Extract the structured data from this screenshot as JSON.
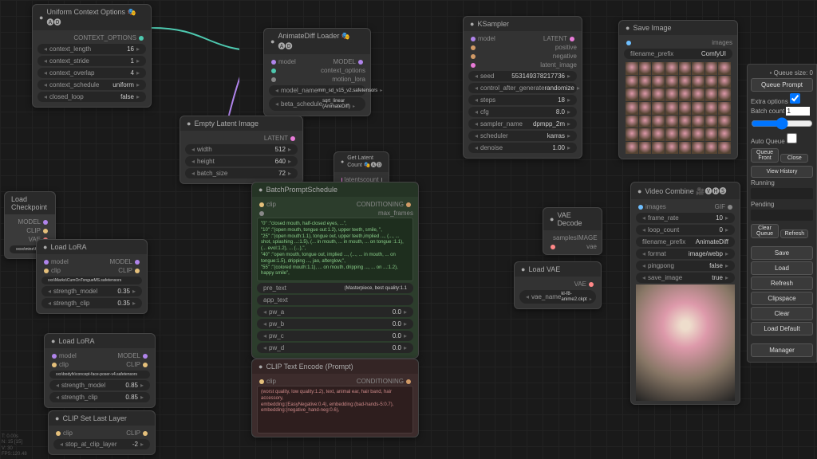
{
  "nodes": {
    "context_options": {
      "title": "Uniform Context Options 🎭🅐🅓",
      "out": "CONTEXT_OPTIONS",
      "widgets": {
        "context_length": {
          "label": "context_length",
          "value": "16"
        },
        "context_stride": {
          "label": "context_stride",
          "value": "1"
        },
        "context_overlap": {
          "label": "context_overlap",
          "value": "4"
        },
        "context_schedule": {
          "label": "context_schedule",
          "value": "uniform"
        },
        "closed_loop": {
          "label": "closed_loop",
          "value": "false"
        }
      }
    },
    "animatediff": {
      "title": "AnimateDiff Loader 🎭🅐🅓",
      "inputs": [
        "model",
        "context_options",
        "motion_lora"
      ],
      "out": "MODEL",
      "widgets": {
        "model_name": {
          "label": "model_name",
          "value": "mm_sd_v15_v2.safetensors"
        },
        "beta_schedule": {
          "label": "beta_schedule",
          "value": "sqrt_linear (AnimateDiff)"
        }
      }
    },
    "empty_latent": {
      "title": "Empty Latent Image",
      "out": "LATENT",
      "widgets": {
        "width": {
          "label": "width",
          "value": "512"
        },
        "height": {
          "label": "height",
          "value": "640"
        },
        "batch_size": {
          "label": "batch_size",
          "value": "72"
        }
      }
    },
    "get_latent_count": {
      "title": "Get Latent Count 🎭🅐🅓",
      "inputs": [
        "latents"
      ],
      "out": "count"
    },
    "ksampler": {
      "title": "KSampler",
      "inputs": [
        "model",
        "positive",
        "negative",
        "latent_image"
      ],
      "out": "LATENT",
      "widgets": {
        "seed": {
          "label": "seed",
          "value": "553149378217736"
        },
        "control_after_generate": {
          "label": "control_after_generate",
          "value": "randomize"
        },
        "steps": {
          "label": "steps",
          "value": "18"
        },
        "cfg": {
          "label": "cfg",
          "value": "8.0"
        },
        "sampler_name": {
          "label": "sampler_name",
          "value": "dpmpp_2m"
        },
        "scheduler": {
          "label": "scheduler",
          "value": "karras"
        },
        "denoise": {
          "label": "denoise",
          "value": "1.00"
        }
      }
    },
    "save_image": {
      "title": "Save Image",
      "inputs": [
        "images"
      ],
      "widgets": {
        "filename_prefix": {
          "label": "filename_prefix",
          "value": "ComfyUI"
        }
      }
    },
    "load_checkpoint": {
      "title": "Load Checkpoint",
      "outs": [
        "MODEL",
        "CLIP",
        "VAE"
      ],
      "widgets": {
        "ckpt_name": {
          "label": "",
          "value": "xxxx\\mine\\HassakuHentaiModel_v13.safetensors"
        }
      }
    },
    "load_lora_1": {
      "title": "Load LoRA",
      "inputs": [
        "model",
        "clip"
      ],
      "outs": [
        "MODEL",
        "CLIP"
      ],
      "widgets": {
        "lora_name": {
          "label": "",
          "value": "xxx\\Marks\\CumOnTongueMS.safetensors"
        },
        "strength_model": {
          "label": "strength_model",
          "value": "0.35"
        },
        "strength_clip": {
          "label": "strength_clip",
          "value": "0.35"
        }
      }
    },
    "load_lora_2": {
      "title": "Load LoRA",
      "inputs": [
        "model",
        "clip"
      ],
      "outs": [
        "MODEL",
        "CLIP"
      ],
      "widgets": {
        "lora_name": {
          "label": "",
          "value": "xxx\\bodyfx\\concept-face-poser-v4.safetensors"
        },
        "strength_model": {
          "label": "strength_model",
          "value": "0.85"
        },
        "strength_clip": {
          "label": "strength_clip",
          "value": "0.85"
        }
      }
    },
    "clip_last_layer": {
      "title": "CLIP Set Last Layer",
      "inputs": [
        "clip"
      ],
      "out": "CLIP",
      "widgets": {
        "stop_at_clip_layer": {
          "label": "stop_at_clip_layer",
          "value": "-2"
        }
      }
    },
    "batch_prompt": {
      "title": "BatchPromptSchedule",
      "inputs": [
        "clip",
        "max_frames"
      ],
      "out": "CONDITIONING",
      "text": "\"0\" :\"closed mouth, half-closed eyes, ...\",\n\"10\" :\"(open mouth, tongue out:1.2), upper teeth, smile, \",\n\"25\" :\"(open mouth:1.1), tongue out, upper teeth,implied ..., (..., ... shot, splashing ...:1.5), (... in mouth, ... in mouth, ... on tongue :1.1), (... evol:1.2), ... (...),\",\n\"40\" :\"open mouth, tongue out, implied ..., (..., ... in mouth, ... on tongue:1.5), dripping ..., jao, afterglow,\",\n\"55\" :\"(colored mouth:1.1), ... on mouth, dripping ..., ... on ...:1.2), happy smile\",",
      "widgets": {
        "pre_text": {
          "label": "pre_text",
          "value": "(Masterpiece, best quality:1.1"
        },
        "app_text": {
          "label": "app_text",
          "value": ""
        },
        "pw_a": {
          "label": "pw_a",
          "value": "0.0"
        },
        "pw_b": {
          "label": "pw_b",
          "value": "0.0"
        },
        "pw_c": {
          "label": "pw_c",
          "value": "0.0"
        },
        "pw_d": {
          "label": "pw_d",
          "value": "0.0"
        }
      }
    },
    "clip_text_neg": {
      "title": "CLIP Text Encode (Prompt)",
      "inputs": [
        "clip"
      ],
      "out": "CONDITIONING",
      "text": "(worst quality, low quality:1.2), text, animal ear, hair band, hair accessory,\nembedding:(EasyNegative:0.4), embedding:(bad-hands-5:0.7), embedding:(negative_hand-neg:0.6),"
    },
    "vae_decode": {
      "title": "VAE Decode",
      "inputs": [
        "samples",
        "vae"
      ],
      "out": "IMAGE"
    },
    "load_vae": {
      "title": "Load VAE",
      "out": "VAE",
      "widgets": {
        "vae_name": {
          "label": "vae_name",
          "value": "kl-f8-anime2.ckpt"
        }
      }
    },
    "video_combine": {
      "title": "Video Combine 🎥🅥🅗🅢",
      "inputs": [
        "images"
      ],
      "out": "GIF",
      "widgets": {
        "frame_rate": {
          "label": "frame_rate",
          "value": "10"
        },
        "loop_count": {
          "label": "loop_count",
          "value": "0"
        },
        "filename_prefix": {
          "label": "filename_prefix",
          "value": "AnimateDiff"
        },
        "format": {
          "label": "format",
          "value": "image/webp"
        },
        "pingpong": {
          "label": "pingpong",
          "value": "false"
        },
        "save_image": {
          "label": "save_image",
          "value": "true"
        }
      }
    }
  },
  "sidebar": {
    "queue_size": "Queue size: 0",
    "queue_prompt": "Queue Prompt",
    "extra_options": "Extra options",
    "batch_count": "Batch count",
    "batch_count_value": "1",
    "auto_queue": "Auto Queue",
    "queue_front": "Queue Front",
    "close": "Close",
    "view_history": "View History",
    "running": "Running",
    "pending": "Pending",
    "clear_queue": "Clear Queue",
    "refresh_small": "Refresh",
    "save": "Save",
    "load": "Load",
    "refresh": "Refresh",
    "clipspace": "Clipspace",
    "clear": "Clear",
    "load_default": "Load Default",
    "manager": "Manager"
  },
  "perf": {
    "line1": "T: 0.00s",
    "line2": "N: 15 [15]",
    "line3": "V: 30",
    "line4": "FPS:120.48"
  }
}
